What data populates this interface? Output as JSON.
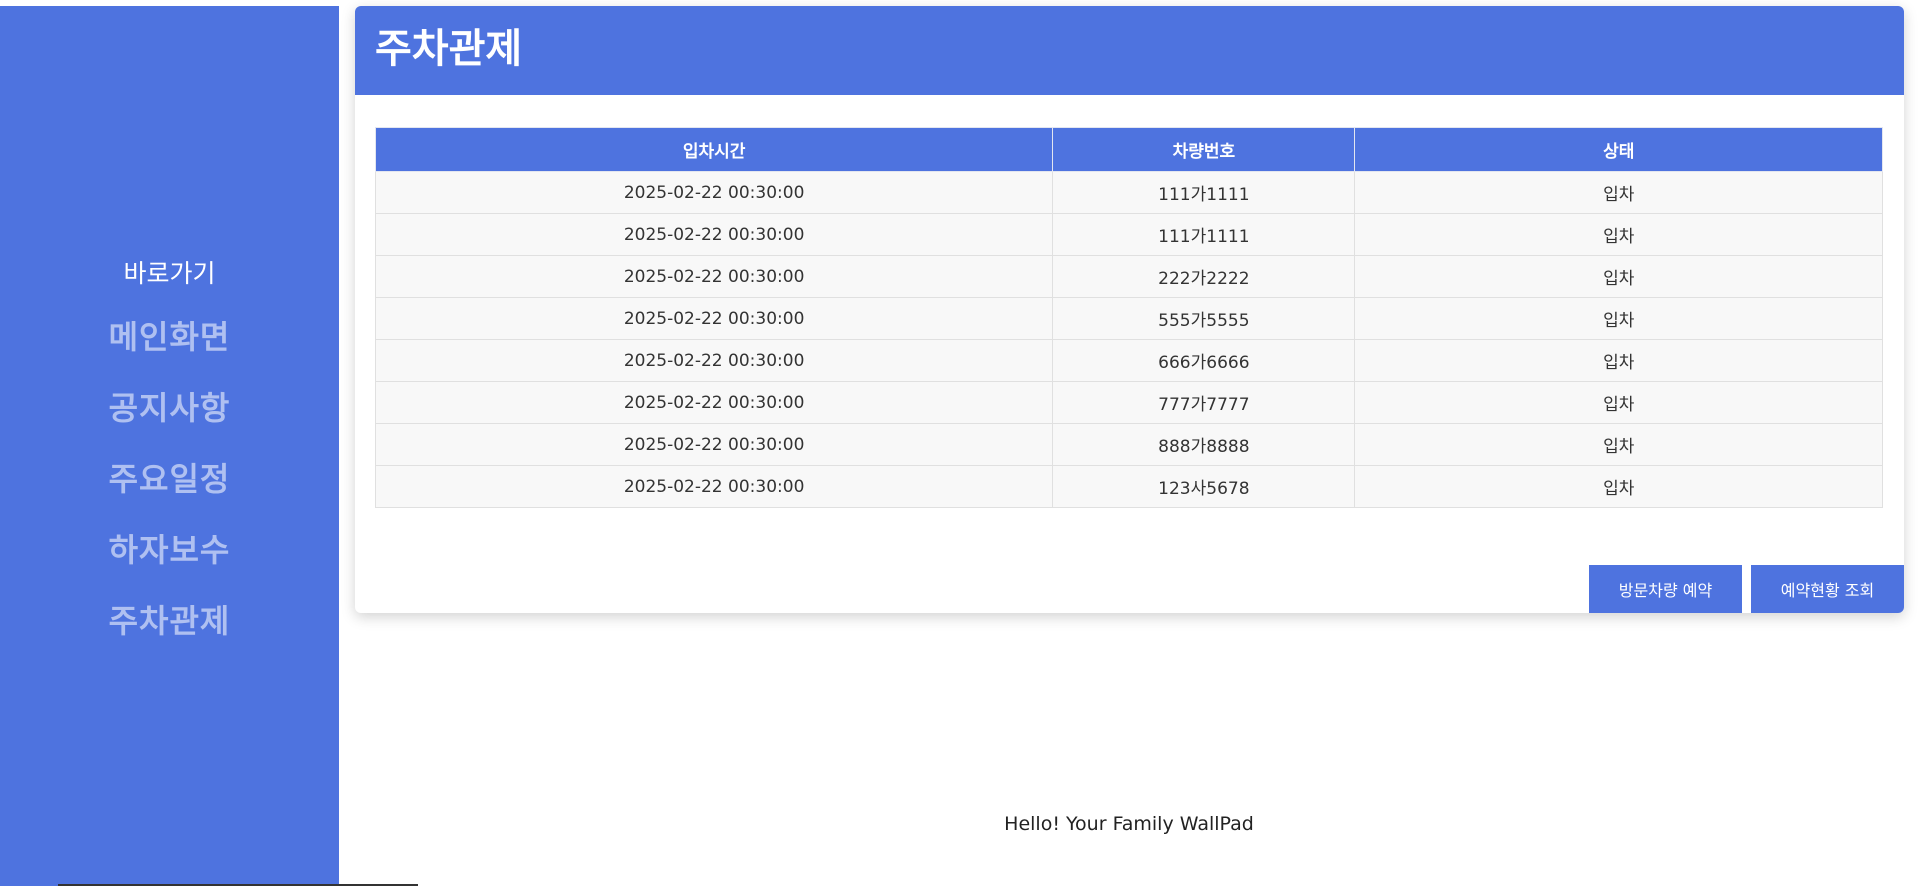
{
  "sidebar": {
    "shortcut_label": "바로가기",
    "items": [
      {
        "label": "메인화면"
      },
      {
        "label": "공지사항"
      },
      {
        "label": "주요일정"
      },
      {
        "label": "하자보수"
      },
      {
        "label": "주차관제"
      }
    ]
  },
  "main": {
    "title": "주차관제",
    "table": {
      "headers": [
        "입차시간",
        "차량번호",
        "상태"
      ],
      "rows": [
        [
          "2025-02-22 00:30:00",
          "111가1111",
          "입차"
        ],
        [
          "2025-02-22 00:30:00",
          "111가1111",
          "입차"
        ],
        [
          "2025-02-22 00:30:00",
          "222가2222",
          "입차"
        ],
        [
          "2025-02-22 00:30:00",
          "555가5555",
          "입차"
        ],
        [
          "2025-02-22 00:30:00",
          "666가6666",
          "입차"
        ],
        [
          "2025-02-22 00:30:00",
          "777가7777",
          "입차"
        ],
        [
          "2025-02-22 00:30:00",
          "888가8888",
          "입차"
        ],
        [
          "2025-02-22 00:30:00",
          "123사5678",
          "입차"
        ]
      ]
    },
    "buttons": {
      "reserve_label": "방문차량 예약",
      "lookup_label": "예약현황 조회"
    }
  },
  "footer": {
    "text": "Hello! Your Family WallPad"
  },
  "colors": {
    "accent": "#4e73df"
  }
}
